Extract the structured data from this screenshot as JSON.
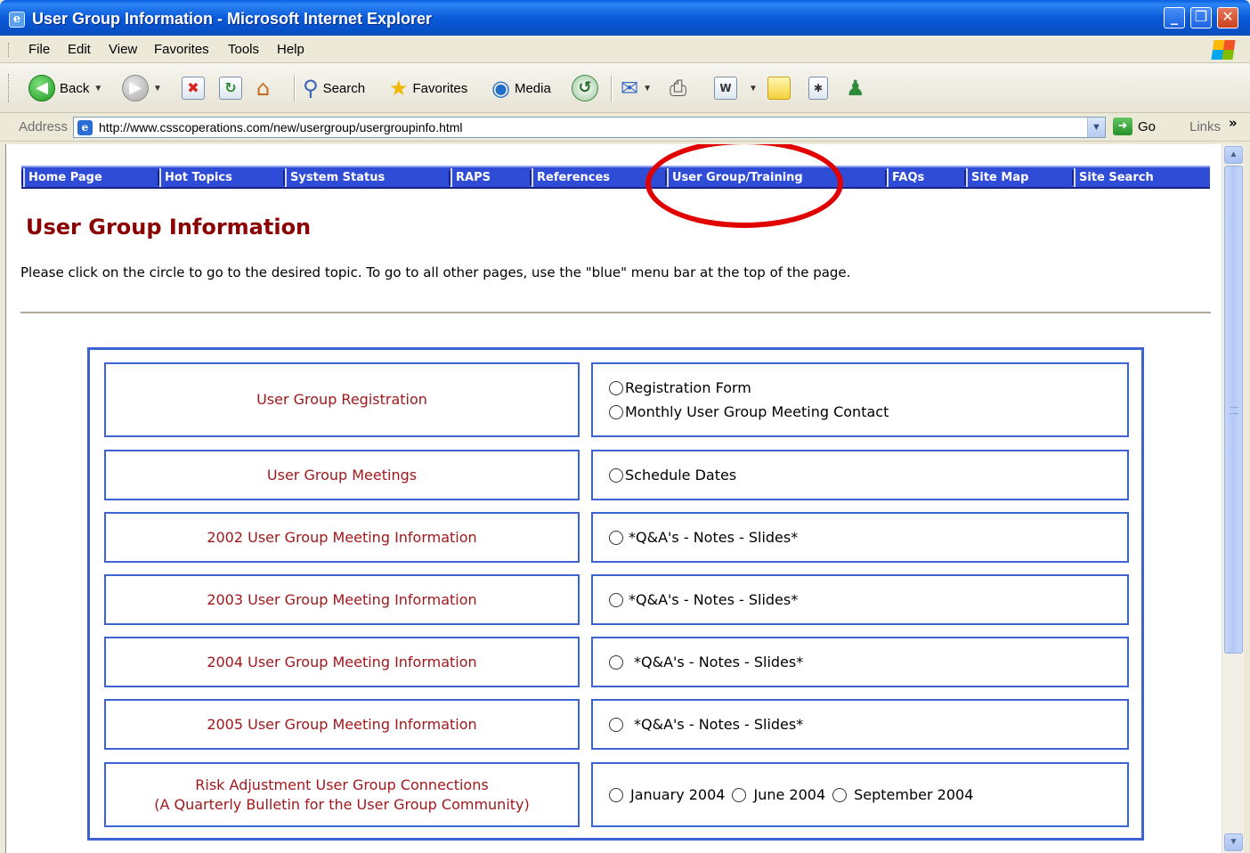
{
  "window": {
    "title": "User Group Information - Microsoft Internet Explorer",
    "app_icon_glyph": "e",
    "controls": {
      "minimize": "_",
      "restore": "❐",
      "close": "✕"
    }
  },
  "menu": {
    "items": [
      "File",
      "Edit",
      "View",
      "Favorites",
      "Tools",
      "Help"
    ]
  },
  "toolbar": {
    "back_label": "Back",
    "search_label": "Search",
    "favorites_label": "Favorites",
    "media_label": "Media",
    "icons": [
      "back-icon",
      "forward-icon",
      "stop-icon",
      "refresh-icon",
      "home-icon",
      "search-icon",
      "favorites-star-icon",
      "media-icon",
      "history-icon",
      "mail-icon",
      "print-icon",
      "edit-icon",
      "discuss-icon",
      "research-icon",
      "messenger-icon"
    ]
  },
  "address": {
    "label": "Address",
    "url": "http://www.csscoperations.com/new/usergroup/usergroupinfo.html",
    "go_label": "Go",
    "links_label": "Links",
    "links_chevron": "»"
  },
  "nav": {
    "items": [
      "Home Page",
      "Hot Topics",
      "System Status",
      "RAPS",
      "References",
      "User Group/Training",
      "FAQs",
      "Site Map",
      "Site Search"
    ],
    "highlighted": "User Group/Training",
    "highlight_color": "#e00000",
    "bar_color": "#2f4cd6"
  },
  "page": {
    "title": "User Group Information",
    "intro": "Please click on the circle to go to the desired topic. To go to all other pages, use the \"blue\" menu bar at the top of the page.",
    "title_color": "#8b0000",
    "link_color": "#a0181c"
  },
  "topics": [
    {
      "label": "User Group Registration",
      "options": [
        "Registration Form",
        "Monthly User Group Meeting Contact"
      ]
    },
    {
      "label": "User Group Meetings",
      "options": [
        "Schedule Dates"
      ]
    },
    {
      "label": "2002 User Group Meeting Information",
      "options": [
        "*Q&A's - Notes - Slides*"
      ]
    },
    {
      "label": "2003 User Group Meeting Information",
      "options": [
        "*Q&A's - Notes - Slides*"
      ]
    },
    {
      "label": "2004 User Group Meeting Information",
      "options": [
        "*Q&A's - Notes - Slides*"
      ]
    },
    {
      "label": "2005 User Group Meeting Information",
      "options": [
        "*Q&A's - Notes - Slides*"
      ]
    },
    {
      "label_line1": "Risk Adjustment User Group Connections",
      "label_line2": "(A Quarterly Bulletin for the User Group Community)",
      "options": [
        "January 2004",
        "June 2004",
        "September 2004"
      ]
    }
  ]
}
